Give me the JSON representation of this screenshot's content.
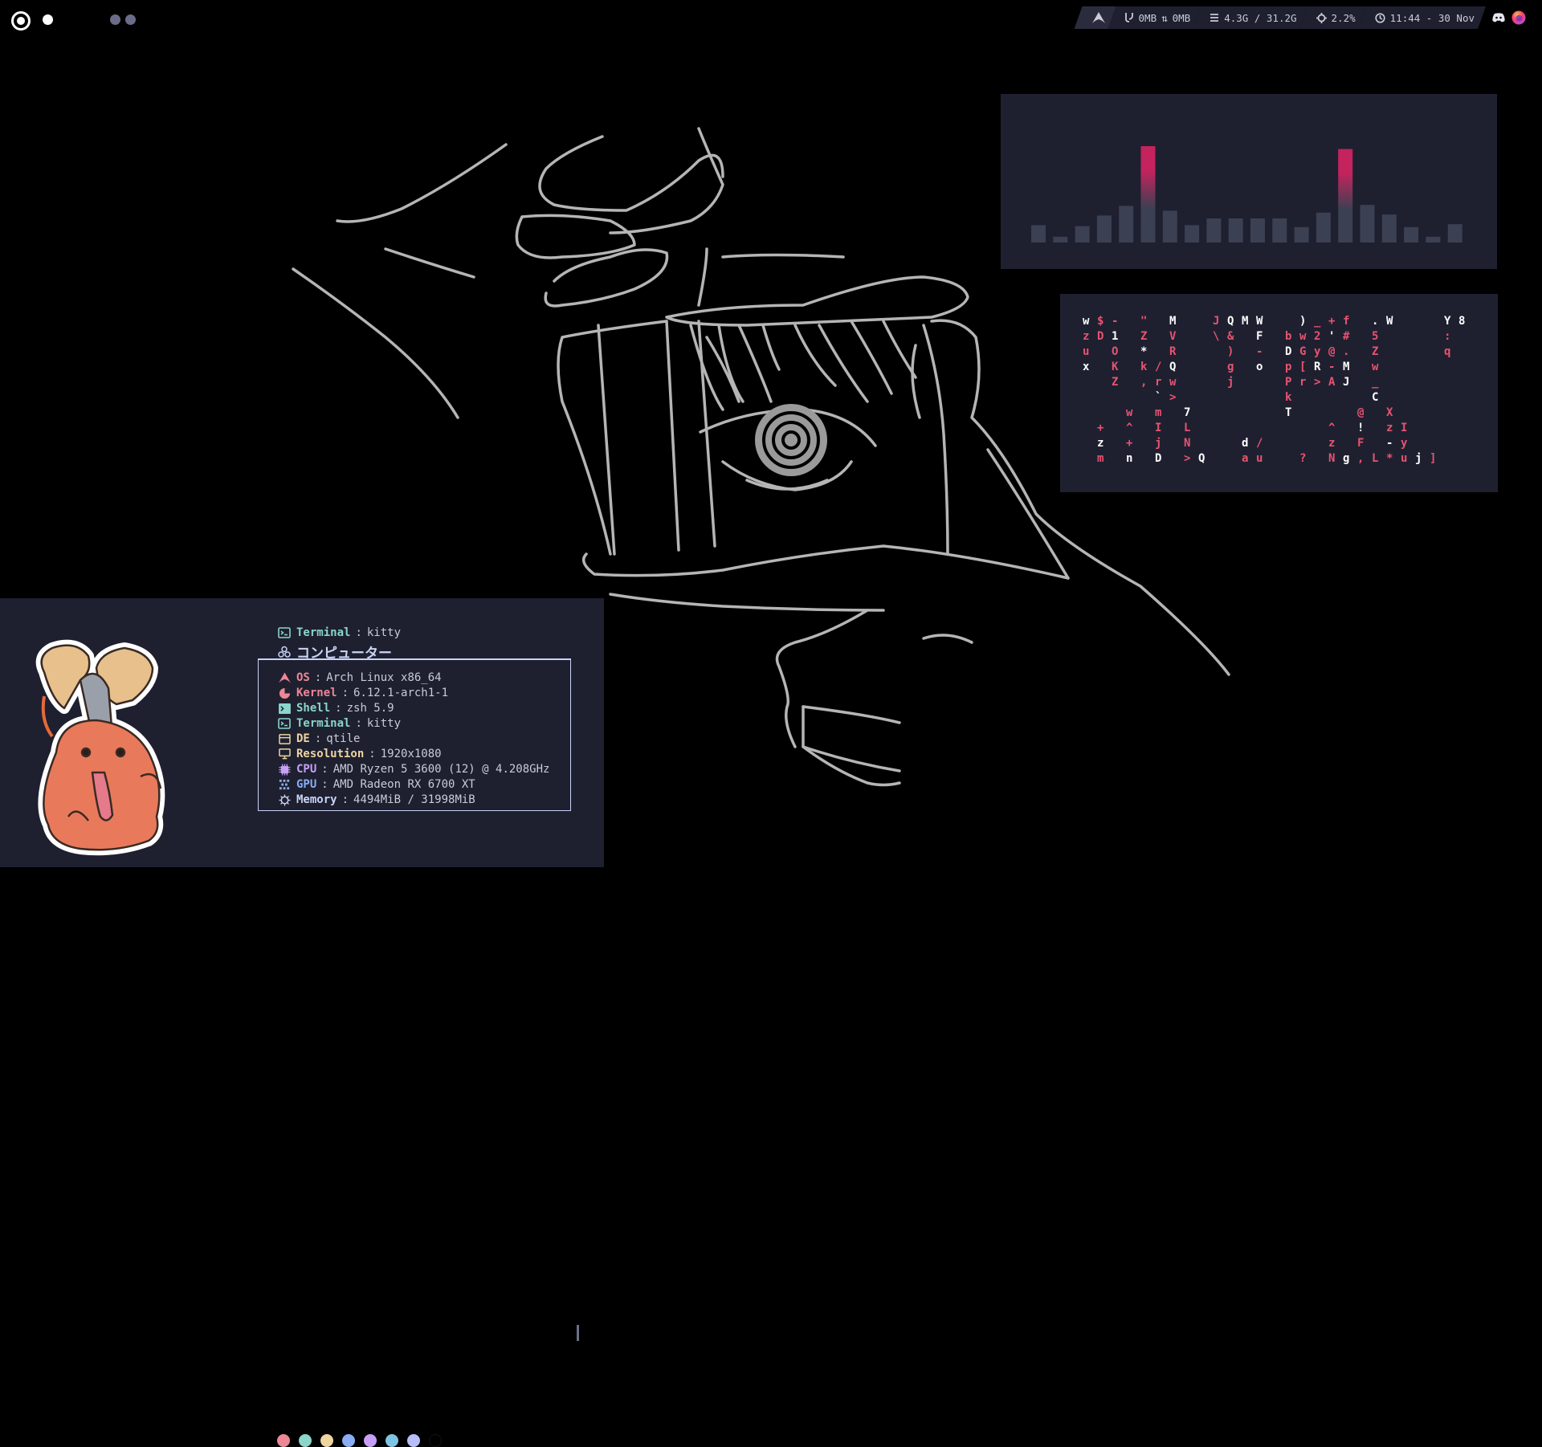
{
  "topbar": {
    "workspaces": [
      "active",
      "occupied",
      "empty",
      "empty"
    ],
    "net_down": "0MB",
    "net_up": "0MB",
    "memory": "4.3G / 31.2G",
    "cpu": "2.2%",
    "clock": "11:44 - 30 Nov",
    "icons": [
      "arch-icon",
      "network-icon",
      "memory-icon",
      "cpu-icon",
      "clock-icon",
      "discord-icon",
      "firefox-icon"
    ]
  },
  "visualizer": {
    "bar_colors": {
      "base": "#3b4052",
      "peak": "#c4235d"
    },
    "levels": [
      0.18,
      0.06,
      0.17,
      0.28,
      0.38,
      1.0,
      0.33,
      0.18,
      0.25,
      0.25,
      0.25,
      0.25,
      0.16,
      0.31,
      0.97,
      0.39,
      0.29,
      0.16,
      0.06,
      0.19
    ]
  },
  "matrix": {
    "rows": [
      "w $ -   \"   M     J Q M W     ) _ + f   . W       Y 8",
      "z D 1   Z   V     \\ &   F   b w 2 ' #   5         :",
      "u   O   *   R       )   -   D G y @ .   Z         q",
      "x   K   k / Q       g   o   p [ R - M   w",
      "    Z   , r w       j       P r > A J   _",
      "          ` >               k           C",
      "      w   m   7             T         @   X",
      "  +   ^   I   L                   ^   !   z I",
      "  z   +   j   N       d /         z   F   - y",
      "  m   n   D   > Q     a u     ?   N g , L * u j ]"
    ]
  },
  "fetch": {
    "header_key": "Terminal",
    "header_value": "kitty",
    "hostname": "コンピューター",
    "rows": [
      {
        "key": "OS",
        "value": "Arch Linux x86_64",
        "icon": "arch-icon",
        "color": "#ed8796"
      },
      {
        "key": "Kernel",
        "value": "6.12.1-arch1-1",
        "icon": "kernel-icon",
        "color": "#ed8796"
      },
      {
        "key": "Shell",
        "value": "zsh 5.9",
        "icon": "shell-icon",
        "color": "#8bd5ca"
      },
      {
        "key": "Terminal",
        "value": "kitty",
        "icon": "terminal-icon",
        "color": "#8bd5ca"
      },
      {
        "key": "DE",
        "value": "qtile",
        "icon": "desktop-icon",
        "color": "#eed49f"
      },
      {
        "key": "Resolution",
        "value": "1920x1080",
        "icon": "monitor-icon",
        "color": "#eed49f"
      },
      {
        "key": "CPU",
        "value": "AMD Ryzen 5 3600 (12) @ 4.208GHz",
        "icon": "cpu-icon",
        "color": "#c6a0f6"
      },
      {
        "key": "GPU",
        "value": "AMD Radeon RX 6700 XT",
        "icon": "gpu-icon",
        "color": "#8aadf4"
      },
      {
        "key": "Memory",
        "value": "4494MiB / 31998MiB",
        "icon": "memory-icon",
        "color": "#c9d4f5"
      }
    ],
    "separator": ":",
    "palette": [
      "#ed8796",
      "#8bd5ca",
      "#eed49f",
      "#8aadf4",
      "#c6a0f6",
      "#7dc4e4",
      "#b7bdf8",
      "#000000"
    ]
  }
}
